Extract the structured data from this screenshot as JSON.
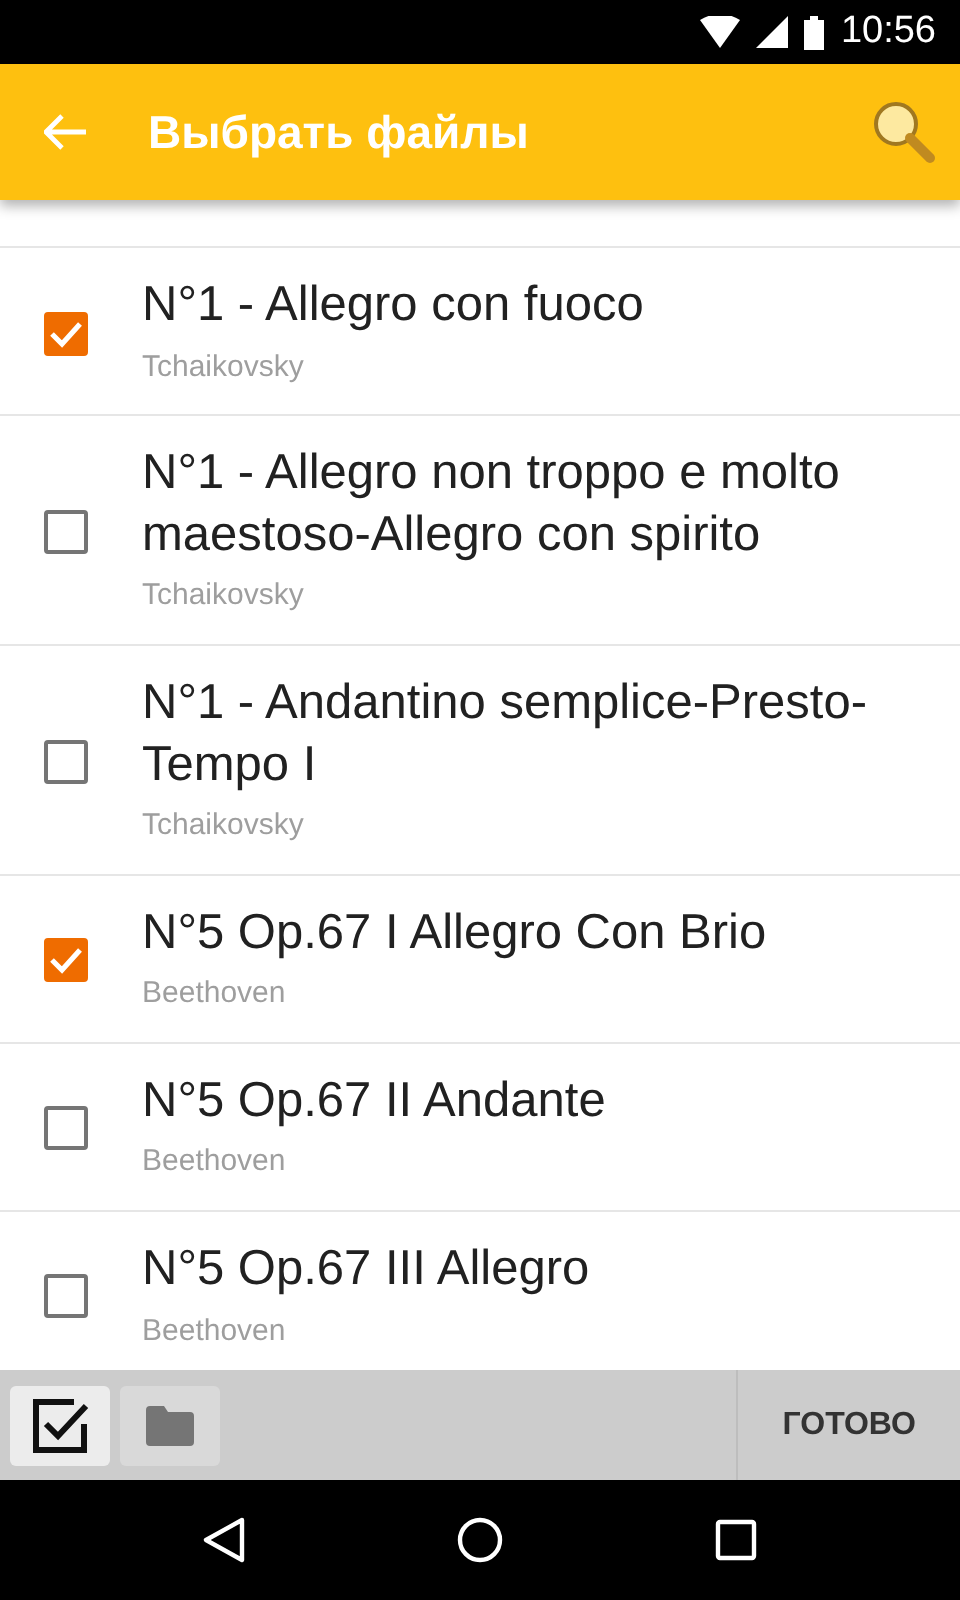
{
  "status_bar": {
    "time": "10:56"
  },
  "app_bar": {
    "title": "Выбрать файлы"
  },
  "tracks": [
    {
      "title": "N°1 - Allegro con fuoco",
      "artist": "Tchaikovsky",
      "checked": true,
      "kind": "full"
    },
    {
      "title": "N°1 - Allegro non troppo e molto maestoso-Allegro con spirito",
      "artist": "Tchaikovsky",
      "checked": false,
      "kind": "full"
    },
    {
      "title": "N°1 - Andantino semplice-Presto-Tempo I",
      "artist": "Tchaikovsky",
      "checked": false,
      "kind": "full"
    },
    {
      "title": "N°5 Op.67 I Allegro Con Brio",
      "artist": "Beethoven",
      "checked": true,
      "kind": "full"
    },
    {
      "title": "N°5 Op.67 II Andante",
      "artist": "Beethoven",
      "checked": false,
      "kind": "full"
    },
    {
      "title": "N°5 Op.67 III Allegro",
      "artist": "Beethoven",
      "checked": false,
      "kind": "full"
    }
  ],
  "bottom_bar": {
    "done": "ГОТОВО",
    "select_all_selected": true
  }
}
